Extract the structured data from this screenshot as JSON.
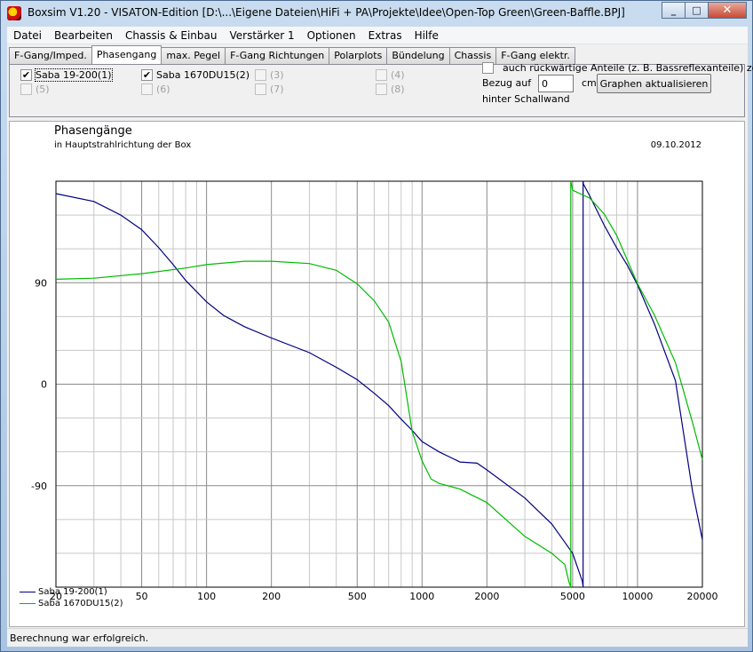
{
  "window": {
    "title": "Boxsim V1.20 - VISATON-Edition [D:\\...\\Eigene Dateien\\HiFi + PA\\Projekte\\Idee\\Open-Top Green\\Green-Baffle.BPJ]",
    "minimize": "_",
    "maximize": "□",
    "close": "✕"
  },
  "menu": [
    "Datei",
    "Bearbeiten",
    "Chassis & Einbau",
    "Verstärker 1",
    "Optionen",
    "Extras",
    "Hilfe"
  ],
  "tabs": [
    {
      "label": "F-Gang/Imped.",
      "active": false
    },
    {
      "label": "Phasengang",
      "active": true
    },
    {
      "label": "max. Pegel",
      "active": false
    },
    {
      "label": "F-Gang Richtungen",
      "active": false
    },
    {
      "label": "Polarplots",
      "active": false
    },
    {
      "label": "Bündelung",
      "active": false
    },
    {
      "label": "Chassis",
      "active": false
    },
    {
      "label": "F-Gang elektr.",
      "active": false
    }
  ],
  "driver_checkboxes": [
    {
      "label": "Saba 19-200(1)",
      "checked": true,
      "enabled": true
    },
    {
      "label": "Saba 1670DU15(2)",
      "checked": true,
      "enabled": true
    },
    {
      "label": "(3)",
      "checked": false,
      "enabled": false
    },
    {
      "label": "(4)",
      "checked": false,
      "enabled": false
    },
    {
      "label": "(5)",
      "checked": false,
      "enabled": false
    },
    {
      "label": "(6)",
      "checked": false,
      "enabled": false
    },
    {
      "label": "(7)",
      "checked": false,
      "enabled": false
    },
    {
      "label": "(8)",
      "checked": false,
      "enabled": false
    }
  ],
  "options": {
    "rear_components_label": "auch rückwärtige Anteile (z. B. Bassreflexanteile) zeigen",
    "rear_components_checked": false,
    "bezug_label": "Bezug auf",
    "bezug_value": "0",
    "unit": "cm",
    "hinter_label": "hinter Schallwand",
    "update_button": "Graphen aktualisieren"
  },
  "chart_header": {
    "title": "Phasengänge",
    "subtitle": "in Hauptstrahlrichtung der Box",
    "date": "09.10.2012"
  },
  "status": "Berechnung war erfolgreich.",
  "chart_data": {
    "type": "line",
    "title": "Phasengänge",
    "subtitle": "in Hauptstrahlrichtung der Box",
    "xscale": "log",
    "xlim": [
      20,
      20000
    ],
    "ylim": [
      -180,
      180
    ],
    "xticks": [
      20,
      50,
      100,
      200,
      500,
      1000,
      2000,
      5000,
      10000,
      20000
    ],
    "yticks": [
      90,
      0,
      -90
    ],
    "grid": true,
    "legend_position": "bottom-left",
    "series": [
      {
        "name": "Saba 19-200(1)",
        "color": "#000080",
        "points": [
          [
            20,
            169
          ],
          [
            30,
            162
          ],
          [
            40,
            150
          ],
          [
            50,
            137
          ],
          [
            60,
            121
          ],
          [
            70,
            106
          ],
          [
            80,
            92
          ],
          [
            90,
            82
          ],
          [
            100,
            73
          ],
          [
            120,
            61
          ],
          [
            150,
            51
          ],
          [
            200,
            41
          ],
          [
            300,
            28
          ],
          [
            400,
            15
          ],
          [
            500,
            4
          ],
          [
            600,
            -8
          ],
          [
            700,
            -19
          ],
          [
            800,
            -31
          ],
          [
            900,
            -41
          ],
          [
            1000,
            -51
          ],
          [
            1200,
            -60
          ],
          [
            1500,
            -69
          ],
          [
            1800,
            -70
          ],
          [
            2000,
            -76
          ],
          [
            3000,
            -101
          ],
          [
            4000,
            -124
          ],
          [
            5000,
            -150
          ],
          [
            5550,
            -175
          ],
          [
            5590,
            178
          ],
          [
            6000,
            167
          ],
          [
            7000,
            141
          ],
          [
            8000,
            121
          ],
          [
            9000,
            105
          ],
          [
            10000,
            88
          ],
          [
            12000,
            53
          ],
          [
            15000,
            3
          ],
          [
            18000,
            -95
          ],
          [
            20000,
            -138
          ]
        ]
      },
      {
        "name": "Saba 1670DU15(2)",
        "color": "#00bb00",
        "points": [
          [
            20,
            93
          ],
          [
            30,
            94
          ],
          [
            50,
            98
          ],
          [
            80,
            103
          ],
          [
            100,
            106
          ],
          [
            150,
            109
          ],
          [
            200,
            109
          ],
          [
            300,
            107
          ],
          [
            400,
            101
          ],
          [
            500,
            89
          ],
          [
            600,
            74
          ],
          [
            700,
            55
          ],
          [
            800,
            20
          ],
          [
            900,
            -42
          ],
          [
            1000,
            -68
          ],
          [
            1100,
            -84
          ],
          [
            1200,
            -88
          ],
          [
            1500,
            -93
          ],
          [
            2000,
            -105
          ],
          [
            3000,
            -135
          ],
          [
            4000,
            -150
          ],
          [
            4600,
            -160
          ],
          [
            4800,
            -175
          ],
          [
            4900,
            180
          ],
          [
            5000,
            172
          ],
          [
            6000,
            165
          ],
          [
            7000,
            151
          ],
          [
            8000,
            132
          ],
          [
            10000,
            89
          ],
          [
            12000,
            61
          ],
          [
            15000,
            19
          ],
          [
            18000,
            -34
          ],
          [
            20000,
            -67
          ]
        ]
      }
    ]
  }
}
